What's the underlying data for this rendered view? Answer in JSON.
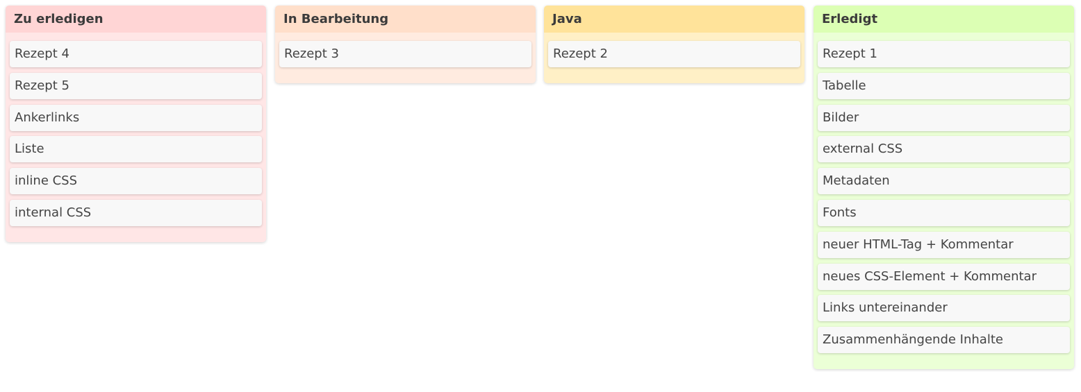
{
  "columns": [
    {
      "title": "Zu erledigen",
      "header_color": "#ffd5d5",
      "body_color": "#ffe6e6",
      "cards": [
        "Rezept 4",
        "Rezept 5",
        "Ankerlinks",
        "Liste",
        "inline CSS",
        "internal CSS"
      ]
    },
    {
      "title": "In Bearbeitung",
      "header_color": "#ffdfca",
      "body_color": "#ffebe0",
      "cards": [
        "Rezept 3"
      ]
    },
    {
      "title": "Java",
      "header_color": "#ffe39a",
      "body_color": "#fff0c6",
      "cards": [
        "Rezept 2"
      ]
    },
    {
      "title": "Erledigt",
      "header_color": "#dcffb4",
      "body_color": "#ebffd6",
      "cards": [
        "Rezept 1",
        "Tabelle",
        "Bilder",
        "external CSS",
        "Metadaten",
        "Fonts",
        "neuer HTML-Tag + Kommentar",
        "neues CSS-Element + Kommentar",
        "Links untereinander",
        "Zusammenhängende Inhalte"
      ]
    }
  ]
}
